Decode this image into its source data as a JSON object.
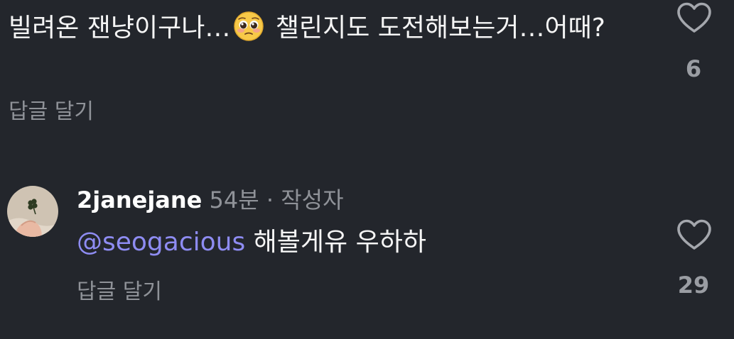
{
  "comment": {
    "text_before_emoji": "빌려온 잰냥이구나…",
    "emoji_icon": "pleading-face-emoji",
    "text_after_emoji": " 챌린지도 도전해보는거…어때?",
    "reply_label": "답글 달기",
    "like_count": "6"
  },
  "reply": {
    "username": "2janejane",
    "time": "54분",
    "separator": " · ",
    "author_badge": "작성자",
    "mention": "@seogacious",
    "text": " 해볼게유 우하하",
    "reply_label": "답글 달기",
    "like_count": "29"
  },
  "colors": {
    "background": "#23262c",
    "text": "#f5f5f5",
    "muted": "#8f9298",
    "mention": "#8e8cf2"
  }
}
